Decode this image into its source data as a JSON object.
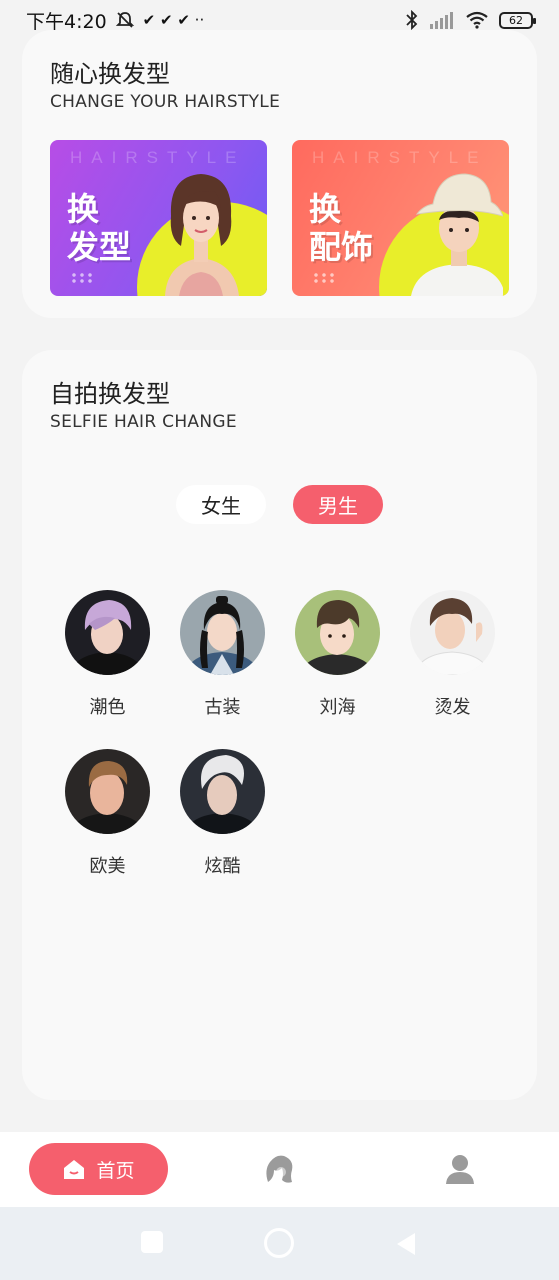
{
  "status_bar": {
    "time": "下午4:20",
    "notification_icons": "✔ ✔ ✔ ··",
    "battery": "62"
  },
  "featured": {
    "title": "随心换发型",
    "subtitle": "CHANGE YOUR HAIRSTYLE",
    "banners": [
      {
        "watermark": "HAIRSTYLE",
        "line1": "换",
        "line2": "发型",
        "gradient": [
          "#b74de6",
          "#6b5cf5"
        ]
      },
      {
        "watermark": "HAIRSTYLE",
        "line1": "换",
        "line2": "配饰",
        "gradient": [
          "#ff6a5e",
          "#ff9a78"
        ]
      }
    ]
  },
  "selfie": {
    "title": "自拍换发型",
    "subtitle": "SELFIE HAIR CHANGE",
    "tabs": {
      "female": "女生",
      "male": "男生",
      "selected": "male"
    },
    "styles": [
      {
        "label": "潮色"
      },
      {
        "label": "古装"
      },
      {
        "label": "刘海"
      },
      {
        "label": "烫发"
      },
      {
        "label": "欧美"
      },
      {
        "label": "炫酷"
      }
    ]
  },
  "bottom_nav": {
    "home_label": "首页",
    "icons": [
      "home-icon",
      "hairstyle-icon",
      "profile-icon"
    ]
  },
  "colors": {
    "accent": "#f55f6d",
    "banner_yellow": "#e8ee2a"
  }
}
